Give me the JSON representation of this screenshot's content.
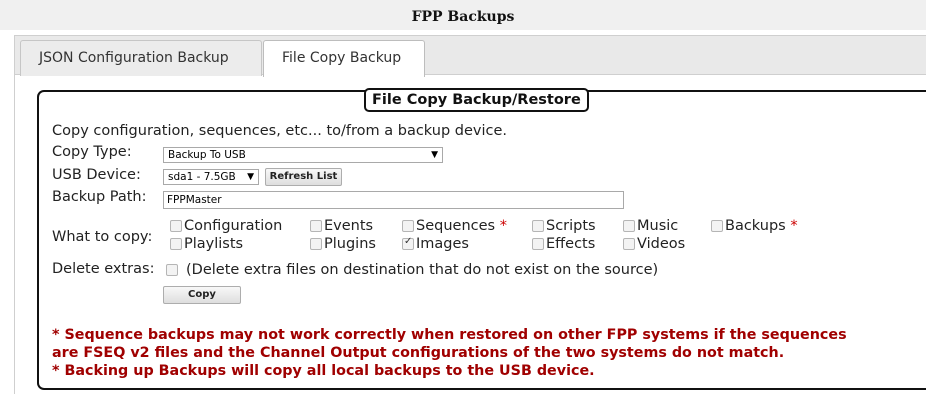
{
  "window_title": "FPP Backups",
  "tabs": [
    {
      "label": "JSON Configuration Backup",
      "active": false
    },
    {
      "label": "File Copy Backup",
      "active": true
    }
  ],
  "panel": {
    "legend": "File Copy Backup/Restore",
    "description": "Copy configuration, sequences, etc... to/from a backup device.",
    "copy_type": {
      "label": "Copy Type:",
      "value": "Backup To USB"
    },
    "usb_device": {
      "label": "USB Device:",
      "value": "sda1 - 7.5GB",
      "refresh_label": "Refresh List"
    },
    "backup_path": {
      "label": "Backup Path:",
      "value": "FPPMaster"
    },
    "what_to_copy": {
      "label": "What to copy:",
      "options": [
        {
          "label": "Configuration",
          "checked": false,
          "star": ""
        },
        {
          "label": "Events",
          "checked": false,
          "star": ""
        },
        {
          "label": "Sequences",
          "checked": false,
          "star": "*"
        },
        {
          "label": "Scripts",
          "checked": false,
          "star": ""
        },
        {
          "label": "Music",
          "checked": false,
          "star": ""
        },
        {
          "label": "Backups",
          "checked": false,
          "star": "*"
        },
        {
          "label": "Playlists",
          "checked": false,
          "star": ""
        },
        {
          "label": "Plugins",
          "checked": false,
          "star": ""
        },
        {
          "label": "Images",
          "checked": true,
          "star": ""
        },
        {
          "label": "Effects",
          "checked": false,
          "star": ""
        },
        {
          "label": "Videos",
          "checked": false,
          "star": ""
        }
      ]
    },
    "delete_extras": {
      "label": "Delete extras:",
      "checked": false,
      "description": "(Delete extra files on destination that do not exist on the source)"
    },
    "copy_button": "Copy",
    "notes": [
      "* Sequence backups may not work correctly when restored on other FPP systems if the sequences",
      "are FSEQ v2 files and the Channel Output configurations of the two systems do not match.",
      "* Backing up Backups will copy all local backups to the USB device."
    ]
  },
  "colors": {
    "note_text": "#a00000",
    "star": "#cc0000"
  }
}
